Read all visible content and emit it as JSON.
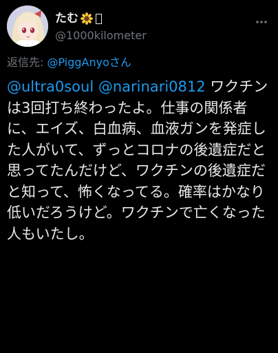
{
  "author": {
    "display_name": "たむ",
    "name_emoji": "sunflower-emoji",
    "handle": "@1000kilometer",
    "avatar": "avatar-anime-girl"
  },
  "reply_context": {
    "prefix": "返信先:",
    "mention": "@PiggAnyoさん"
  },
  "tweet": {
    "mention_1": "@ultra0soul",
    "mention_2": "@narinari0812",
    "text": " ワクチンは3回打ち終わったよ。仕事の関係者に、エイズ、白血病、血液ガンを発症した人がいて、ずっとコロナの後遺症だと思ってたんだけど、ワクチンの後遺症だと知って、怖くなってる。確率はかなり低いだろうけど。ワクチンで亡くなった人もいたし。"
  },
  "icons": {
    "more": "more-horizontal-icon"
  },
  "colors": {
    "background": "#000000",
    "text": "#e7e9ea",
    "secondary": "#71767b",
    "link": "#1d9bf0"
  }
}
